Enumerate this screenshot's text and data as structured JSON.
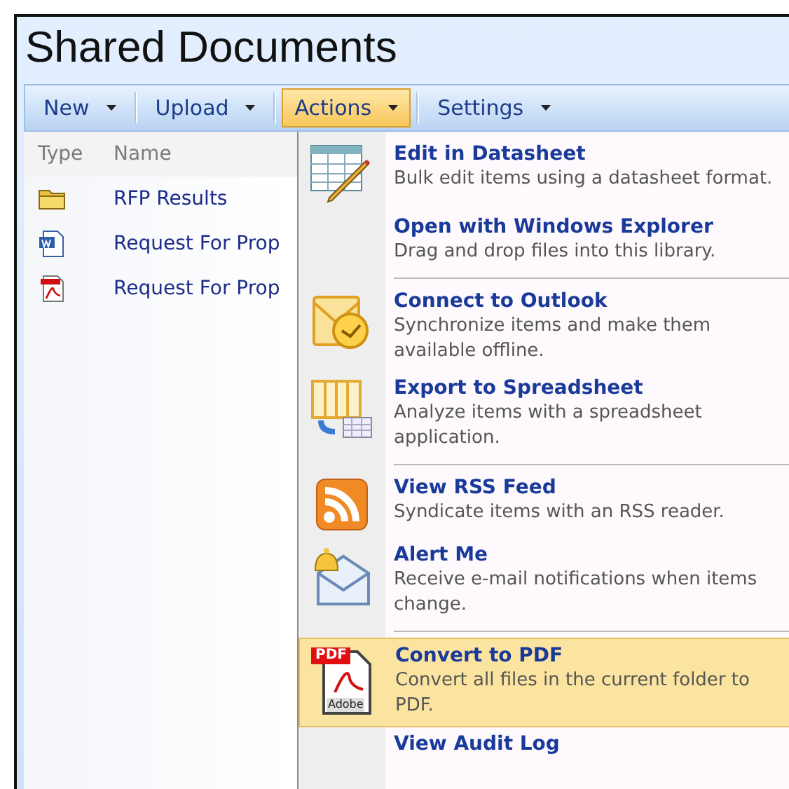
{
  "title": "Shared Documents",
  "toolbar": [
    {
      "label": "New",
      "selected": false
    },
    {
      "label": "Upload",
      "selected": false
    },
    {
      "label": "Actions",
      "selected": true
    },
    {
      "label": "Settings",
      "selected": false
    }
  ],
  "list": {
    "columns": [
      "Type",
      "Name"
    ],
    "rows": [
      {
        "kind": "folder",
        "name": "RFP Results"
      },
      {
        "kind": "word",
        "name": "Request For Prop"
      },
      {
        "kind": "pdf",
        "name": "Request For Prop"
      }
    ]
  },
  "menu_groups": [
    [
      {
        "kind": "datasheet",
        "title": "Edit in Datasheet",
        "description": "Bulk edit items using a datasheet format.",
        "selected": false
      },
      {
        "kind": "plain",
        "title": "Open with Windows Explorer",
        "description": "Drag and drop files into this library.",
        "selected": false
      }
    ],
    [
      {
        "kind": "outlook",
        "title": "Connect to Outlook",
        "description": "Synchronize items and make them available offline.",
        "selected": false
      },
      {
        "kind": "spreadsheet",
        "title": "Export to Spreadsheet",
        "description": "Analyze items with a spreadsheet application.",
        "selected": false
      }
    ],
    [
      {
        "kind": "rss",
        "title": "View RSS Feed",
        "description": "Syndicate items with an RSS reader.",
        "selected": false
      },
      {
        "kind": "alert",
        "title": "Alert Me",
        "description": "Receive e-mail notifications when items change.",
        "selected": false
      }
    ],
    [
      {
        "kind": "pdf",
        "title": "Convert to PDF",
        "description": "Convert all files in the current folder to PDF.",
        "selected": true,
        "icon_label": "PDF",
        "icon_caption": "Adobe"
      },
      {
        "kind": "plain",
        "title": "View Audit Log",
        "selected": false
      }
    ]
  ]
}
